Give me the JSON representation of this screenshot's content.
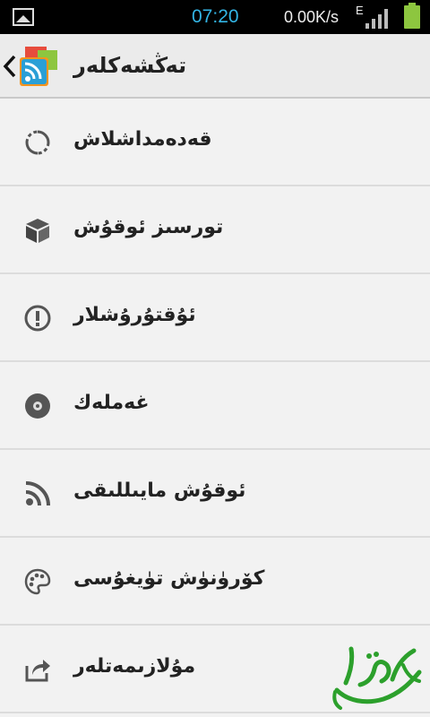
{
  "status_bar": {
    "time": "07:20",
    "net_speed": "0.00K/s",
    "network_type": "E",
    "accent_color": "#33b5e5",
    "battery_color": "#8dc63f"
  },
  "action_bar": {
    "title": "تەڭشەكلەر",
    "back_icon": "chevron-left-icon",
    "app_icon": "rss-app-icon"
  },
  "menu": {
    "items": [
      {
        "label": "قەدەمداشلاش",
        "icon": "sync-icon"
      },
      {
        "label": "تورسىز ئوقۇش",
        "icon": "box-icon"
      },
      {
        "label": "ئۇقتۇرۇشلار",
        "icon": "alert-icon"
      },
      {
        "label": "غەملەك",
        "icon": "disc-icon"
      },
      {
        "label": "ئوقۇش مايىللىقى",
        "icon": "rss-icon"
      },
      {
        "label": "كۆرۈنۈش تۈيغۇسى",
        "icon": "palette-icon"
      },
      {
        "label": "مۇلازىمەتلەر",
        "icon": "share-icon"
      }
    ]
  },
  "watermark": {
    "text": "ئالتۇن",
    "color": "#2ca02c"
  }
}
